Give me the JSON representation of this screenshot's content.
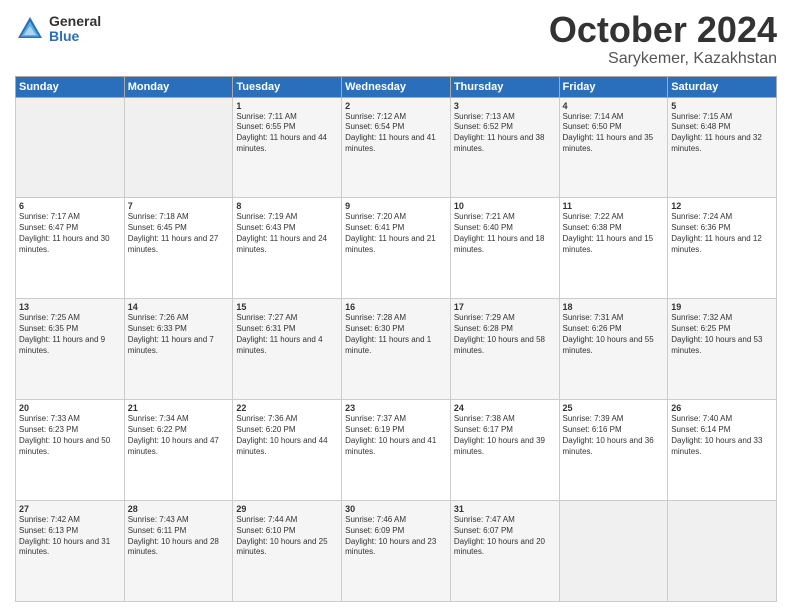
{
  "logo": {
    "general": "General",
    "blue": "Blue"
  },
  "title": {
    "month": "October 2024",
    "location": "Sarykemer, Kazakhstan"
  },
  "weekdays": [
    "Sunday",
    "Monday",
    "Tuesday",
    "Wednesday",
    "Thursday",
    "Friday",
    "Saturday"
  ],
  "weeks": [
    [
      {
        "day": "",
        "info": ""
      },
      {
        "day": "",
        "info": ""
      },
      {
        "day": "1",
        "info": "Sunrise: 7:11 AM\nSunset: 6:55 PM\nDaylight: 11 hours and 44 minutes."
      },
      {
        "day": "2",
        "info": "Sunrise: 7:12 AM\nSunset: 6:54 PM\nDaylight: 11 hours and 41 minutes."
      },
      {
        "day": "3",
        "info": "Sunrise: 7:13 AM\nSunset: 6:52 PM\nDaylight: 11 hours and 38 minutes."
      },
      {
        "day": "4",
        "info": "Sunrise: 7:14 AM\nSunset: 6:50 PM\nDaylight: 11 hours and 35 minutes."
      },
      {
        "day": "5",
        "info": "Sunrise: 7:15 AM\nSunset: 6:48 PM\nDaylight: 11 hours and 32 minutes."
      }
    ],
    [
      {
        "day": "6",
        "info": "Sunrise: 7:17 AM\nSunset: 6:47 PM\nDaylight: 11 hours and 30 minutes."
      },
      {
        "day": "7",
        "info": "Sunrise: 7:18 AM\nSunset: 6:45 PM\nDaylight: 11 hours and 27 minutes."
      },
      {
        "day": "8",
        "info": "Sunrise: 7:19 AM\nSunset: 6:43 PM\nDaylight: 11 hours and 24 minutes."
      },
      {
        "day": "9",
        "info": "Sunrise: 7:20 AM\nSunset: 6:41 PM\nDaylight: 11 hours and 21 minutes."
      },
      {
        "day": "10",
        "info": "Sunrise: 7:21 AM\nSunset: 6:40 PM\nDaylight: 11 hours and 18 minutes."
      },
      {
        "day": "11",
        "info": "Sunrise: 7:22 AM\nSunset: 6:38 PM\nDaylight: 11 hours and 15 minutes."
      },
      {
        "day": "12",
        "info": "Sunrise: 7:24 AM\nSunset: 6:36 PM\nDaylight: 11 hours and 12 minutes."
      }
    ],
    [
      {
        "day": "13",
        "info": "Sunrise: 7:25 AM\nSunset: 6:35 PM\nDaylight: 11 hours and 9 minutes."
      },
      {
        "day": "14",
        "info": "Sunrise: 7:26 AM\nSunset: 6:33 PM\nDaylight: 11 hours and 7 minutes."
      },
      {
        "day": "15",
        "info": "Sunrise: 7:27 AM\nSunset: 6:31 PM\nDaylight: 11 hours and 4 minutes."
      },
      {
        "day": "16",
        "info": "Sunrise: 7:28 AM\nSunset: 6:30 PM\nDaylight: 11 hours and 1 minute."
      },
      {
        "day": "17",
        "info": "Sunrise: 7:29 AM\nSunset: 6:28 PM\nDaylight: 10 hours and 58 minutes."
      },
      {
        "day": "18",
        "info": "Sunrise: 7:31 AM\nSunset: 6:26 PM\nDaylight: 10 hours and 55 minutes."
      },
      {
        "day": "19",
        "info": "Sunrise: 7:32 AM\nSunset: 6:25 PM\nDaylight: 10 hours and 53 minutes."
      }
    ],
    [
      {
        "day": "20",
        "info": "Sunrise: 7:33 AM\nSunset: 6:23 PM\nDaylight: 10 hours and 50 minutes."
      },
      {
        "day": "21",
        "info": "Sunrise: 7:34 AM\nSunset: 6:22 PM\nDaylight: 10 hours and 47 minutes."
      },
      {
        "day": "22",
        "info": "Sunrise: 7:36 AM\nSunset: 6:20 PM\nDaylight: 10 hours and 44 minutes."
      },
      {
        "day": "23",
        "info": "Sunrise: 7:37 AM\nSunset: 6:19 PM\nDaylight: 10 hours and 41 minutes."
      },
      {
        "day": "24",
        "info": "Sunrise: 7:38 AM\nSunset: 6:17 PM\nDaylight: 10 hours and 39 minutes."
      },
      {
        "day": "25",
        "info": "Sunrise: 7:39 AM\nSunset: 6:16 PM\nDaylight: 10 hours and 36 minutes."
      },
      {
        "day": "26",
        "info": "Sunrise: 7:40 AM\nSunset: 6:14 PM\nDaylight: 10 hours and 33 minutes."
      }
    ],
    [
      {
        "day": "27",
        "info": "Sunrise: 7:42 AM\nSunset: 6:13 PM\nDaylight: 10 hours and 31 minutes."
      },
      {
        "day": "28",
        "info": "Sunrise: 7:43 AM\nSunset: 6:11 PM\nDaylight: 10 hours and 28 minutes."
      },
      {
        "day": "29",
        "info": "Sunrise: 7:44 AM\nSunset: 6:10 PM\nDaylight: 10 hours and 25 minutes."
      },
      {
        "day": "30",
        "info": "Sunrise: 7:46 AM\nSunset: 6:09 PM\nDaylight: 10 hours and 23 minutes."
      },
      {
        "day": "31",
        "info": "Sunrise: 7:47 AM\nSunset: 6:07 PM\nDaylight: 10 hours and 20 minutes."
      },
      {
        "day": "",
        "info": ""
      },
      {
        "day": "",
        "info": ""
      }
    ]
  ]
}
